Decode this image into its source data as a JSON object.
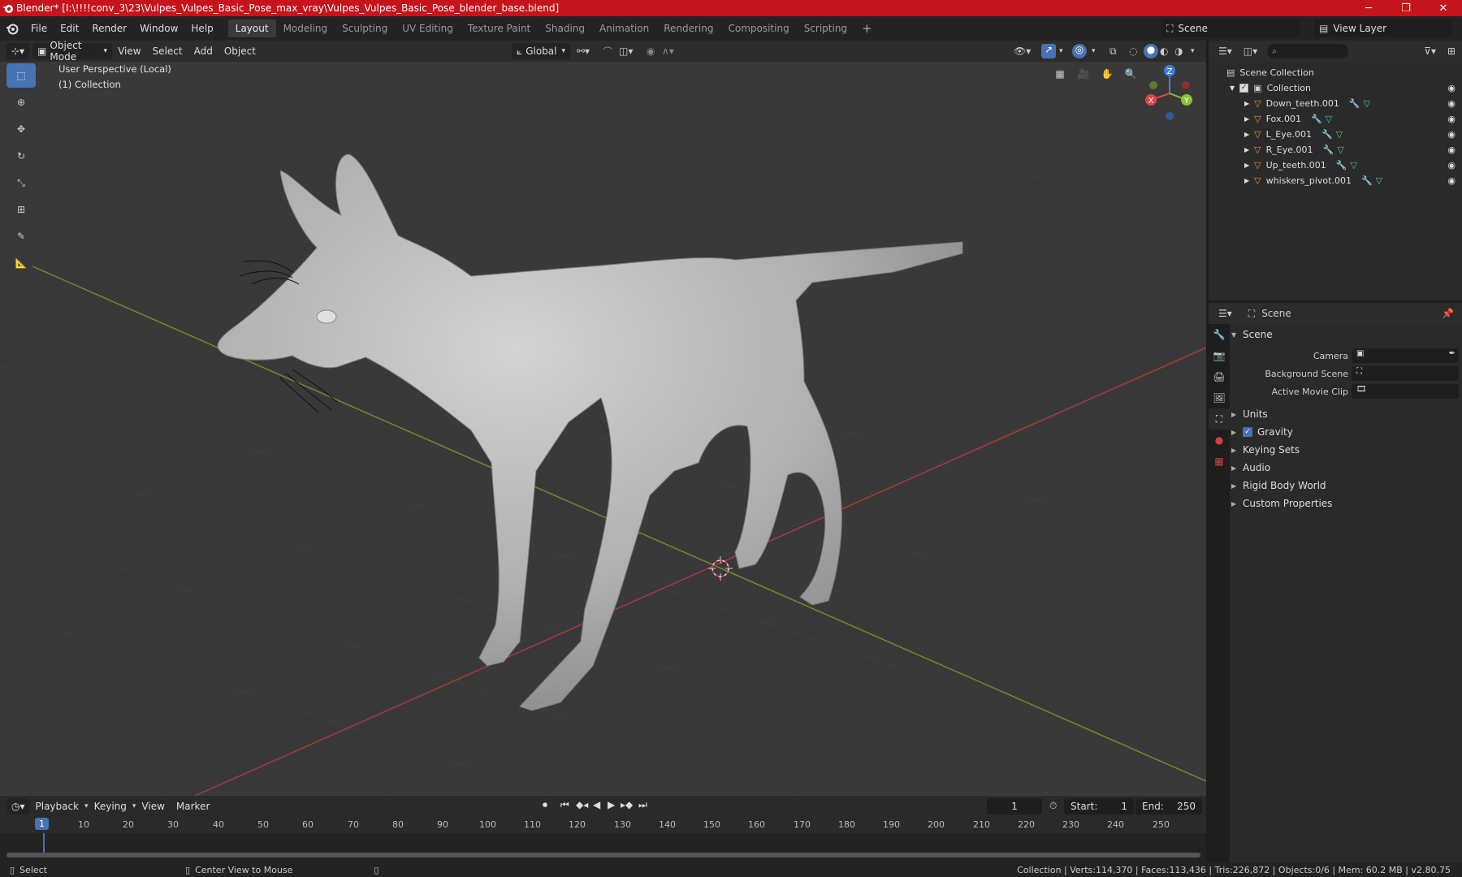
{
  "window": {
    "title": "Blender* [I:\\!!!!conv_3\\23\\Vulpes_Vulpes_Basic_Pose_max_vray\\Vulpes_Vulpes_Basic_Pose_blender_base.blend]",
    "minimize": "─",
    "maximize": "❐",
    "close": "✕"
  },
  "menu": [
    "File",
    "Edit",
    "Render",
    "Window",
    "Help"
  ],
  "workspaces": [
    "Layout",
    "Modeling",
    "Sculpting",
    "UV Editing",
    "Texture Paint",
    "Shading",
    "Animation",
    "Rendering",
    "Compositing",
    "Scripting"
  ],
  "workspace_add": "+",
  "scene_name": "Scene",
  "view_layer": "View Layer",
  "viewport": {
    "mode": "Object Mode",
    "menus": [
      "View",
      "Select",
      "Add",
      "Object"
    ],
    "orientation": "Global",
    "perspective_label": "User Perspective (Local)",
    "collection_label": "(1) Collection",
    "gizmo": {
      "z": "Z",
      "x": "X",
      "y": "Y"
    }
  },
  "outliner": {
    "root": "Scene Collection",
    "collection": "Collection",
    "objects": [
      "Down_teeth.001",
      "Fox.001",
      "L_Eye.001",
      "R_Eye.001",
      "Up_teeth.001",
      "whiskers_pivot.001"
    ]
  },
  "properties": {
    "header": "Scene",
    "panel_title": "Scene",
    "fields": [
      {
        "label": "Camera"
      },
      {
        "label": "Background Scene"
      },
      {
        "label": "Active Movie Clip"
      }
    ],
    "sections": [
      "Units",
      "Gravity",
      "Keying Sets",
      "Audio",
      "Rigid Body World",
      "Custom Properties"
    ]
  },
  "timeline": {
    "menus": [
      "Playback",
      "Keying",
      "View",
      "Marker"
    ],
    "current_frame": "1",
    "start_label": "Start:",
    "start": "1",
    "end_label": "End:",
    "end": "250",
    "ticks": [
      "1",
      "10",
      "20",
      "30",
      "40",
      "50",
      "60",
      "70",
      "80",
      "90",
      "100",
      "110",
      "120",
      "130",
      "140",
      "150",
      "160",
      "170",
      "180",
      "190",
      "200",
      "210",
      "220",
      "230",
      "240",
      "250"
    ]
  },
  "status": {
    "select": "Select",
    "center_view": "Center View to Mouse",
    "stats": "Collection | Verts:114,370 | Faces:113,436 | Tris:226,872 | Objects:0/6 | Mem: 60.2 MB | v2.80.75"
  },
  "colors": {
    "titlebar": "#c5141c",
    "accent": "#4772b3",
    "x_axis": "#e0424a",
    "y_axis": "#8ac232",
    "z_axis": "#3f7fd9",
    "object_icon": "#e8913a"
  }
}
